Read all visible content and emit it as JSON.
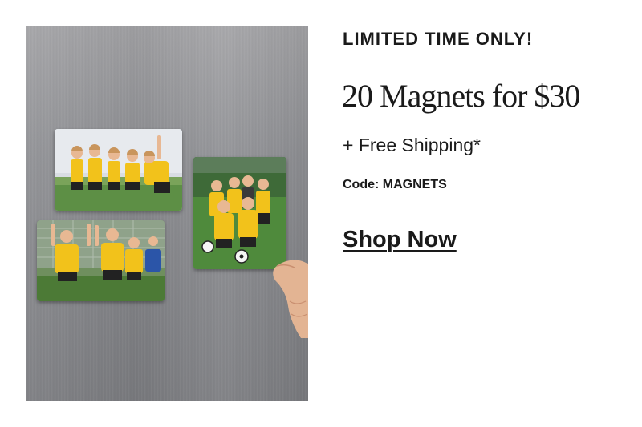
{
  "promo": {
    "eyebrow": "LIMITED TIME ONLY!",
    "headline": "20 Magnets for $30",
    "shipping": "+ Free Shipping*",
    "code": "Code: MAGNETS",
    "cta_label": "Shop Now"
  },
  "colors": {
    "text": "#1a1a1a",
    "background": "#ffffff",
    "jersey": "#f2c21b",
    "grass": "#4f8a3c"
  }
}
